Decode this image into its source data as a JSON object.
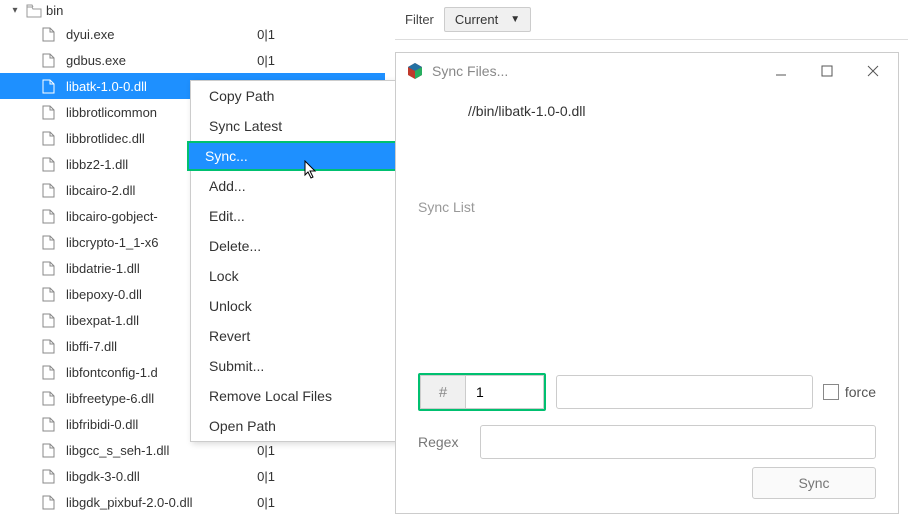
{
  "tree": {
    "folder": "bin",
    "files": [
      {
        "name": "dyui.exe",
        "status": "0|1"
      },
      {
        "name": "gdbus.exe",
        "status": "0|1"
      },
      {
        "name": "libatk-1.0-0.dll",
        "status": "",
        "selected": true
      },
      {
        "name": "libbrotlicommon",
        "status": ""
      },
      {
        "name": "libbrotlidec.dll",
        "status": ""
      },
      {
        "name": "libbz2-1.dll",
        "status": ""
      },
      {
        "name": "libcairo-2.dll",
        "status": ""
      },
      {
        "name": "libcairo-gobject-",
        "status": ""
      },
      {
        "name": "libcrypto-1_1-x6",
        "status": ""
      },
      {
        "name": "libdatrie-1.dll",
        "status": ""
      },
      {
        "name": "libepoxy-0.dll",
        "status": ""
      },
      {
        "name": "libexpat-1.dll",
        "status": ""
      },
      {
        "name": "libffi-7.dll",
        "status": ""
      },
      {
        "name": "libfontconfig-1.d",
        "status": ""
      },
      {
        "name": "libfreetype-6.dll",
        "status": ""
      },
      {
        "name": "libfribidi-0.dll",
        "status": ""
      },
      {
        "name": "libgcc_s_seh-1.dll",
        "status": "0|1"
      },
      {
        "name": "libgdk-3-0.dll",
        "status": "0|1"
      },
      {
        "name": "libgdk_pixbuf-2.0-0.dll",
        "status": "0|1"
      }
    ]
  },
  "contextMenu": {
    "items": [
      {
        "label": "Copy Path"
      },
      {
        "label": "Sync Latest"
      },
      {
        "label": "Sync...",
        "highlighted": true
      },
      {
        "label": "Add..."
      },
      {
        "label": "Edit..."
      },
      {
        "label": "Delete..."
      },
      {
        "label": "Lock"
      },
      {
        "label": "Unlock"
      },
      {
        "label": "Revert"
      },
      {
        "label": "Submit..."
      },
      {
        "label": "Remove Local Files"
      },
      {
        "label": "Open Path"
      }
    ]
  },
  "filter": {
    "label": "Filter",
    "value": "Current"
  },
  "dialog": {
    "title": "Sync Files...",
    "path": "//bin/libatk-1.0-0.dll",
    "syncListLabel": "Sync List",
    "hashLabel": "#",
    "seqValue": "1",
    "forceLabel": "force",
    "regexLabel": "Regex",
    "regexValue": "",
    "textValue": "",
    "syncButton": "Sync"
  }
}
